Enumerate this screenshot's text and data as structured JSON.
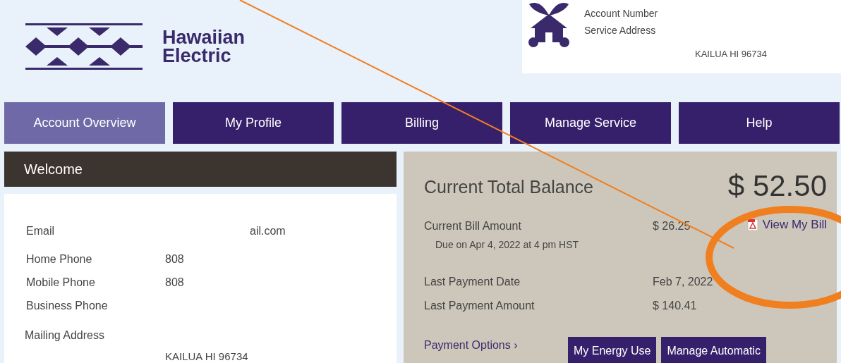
{
  "brand": {
    "name_line_1": "Hawaiian",
    "name_line_2": "Electric"
  },
  "account": {
    "labels": [
      "Account Number",
      "Service Address"
    ],
    "address": "KAILUA HI 96734"
  },
  "nav": [
    {
      "label": "Account Overview",
      "selected": true
    },
    {
      "label": "My Profile",
      "selected": false
    },
    {
      "label": "Billing",
      "selected": false
    },
    {
      "label": "Manage Service",
      "selected": false
    },
    {
      "label": "Help",
      "selected": false
    }
  ],
  "welcome": {
    "title": "Welcome",
    "rows": [
      {
        "label": "Email",
        "value": "ail.com"
      },
      {
        "label": "Home Phone",
        "value": "808"
      },
      {
        "label": "Mobile Phone",
        "value": "808"
      },
      {
        "label": "Business Phone"
      }
    ],
    "mailing_label": "Mailing Address",
    "mailing_value": "KAILUA HI 96734"
  },
  "balance": {
    "title": "Current Total Balance",
    "amount": "$ 52.50",
    "bill_label": "Current Bill Amount",
    "bill_value": "$ 26.25",
    "due": "Due on Apr 4, 2022 at 4 pm HST",
    "view_bill": "View My Bill",
    "rows": [
      {
        "label": "Last Payment Date",
        "value": "Feb 7, 2022"
      },
      {
        "label": "Last Payment Amount",
        "value": "$ 140.41"
      }
    ],
    "payment_options": "Payment Options ›",
    "buttons": [
      "My Energy Use",
      "Manage Automatic"
    ]
  }
}
